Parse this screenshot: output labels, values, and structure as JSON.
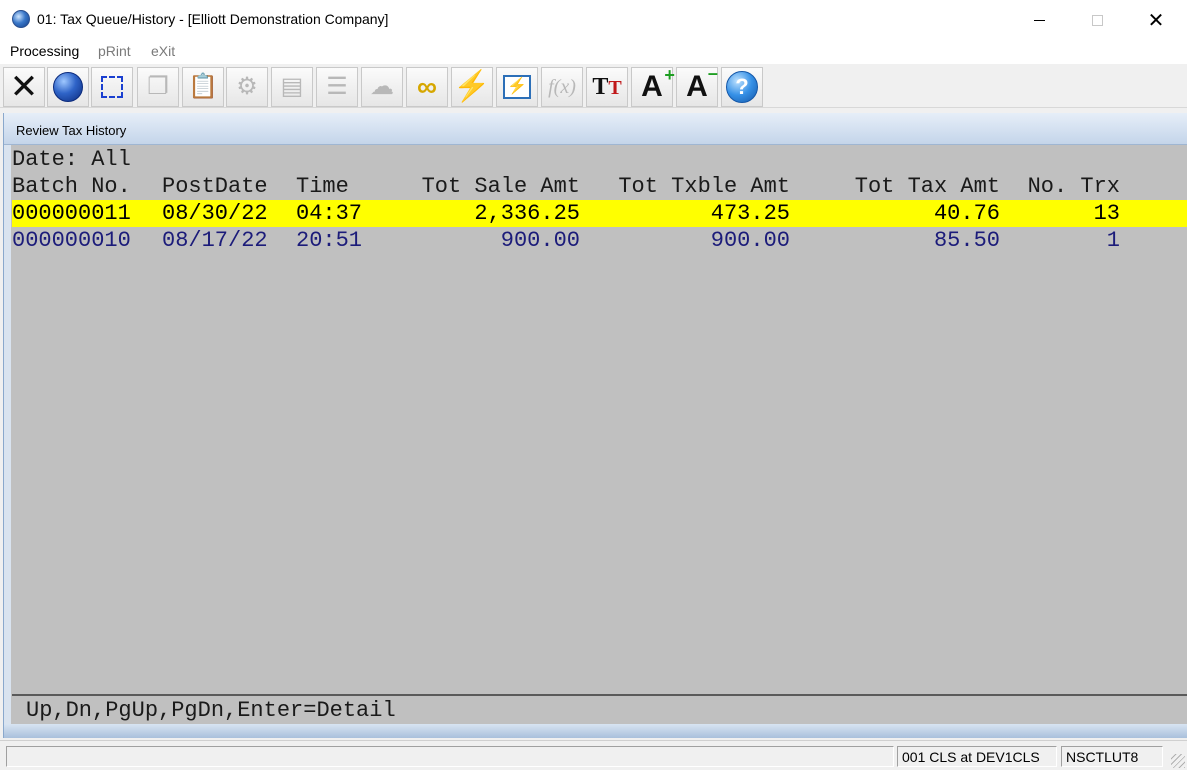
{
  "window": {
    "title": "01: Tax Queue/History - [Elliott Demonstration Company]"
  },
  "menu": {
    "processing": "Processing",
    "print": "pRint",
    "exit": "eXit"
  },
  "toolbar": {
    "items": [
      {
        "icon": "close-icon",
        "enabled": true
      },
      {
        "icon": "globe-icon",
        "enabled": true
      },
      {
        "icon": "select-box-icon",
        "enabled": true
      },
      {
        "icon": "copy-icon",
        "enabled": false
      },
      {
        "icon": "paste-icon",
        "enabled": false
      },
      {
        "icon": "gear-icon",
        "enabled": false
      },
      {
        "icon": "edit-form-icon",
        "enabled": false
      },
      {
        "icon": "table-icon",
        "enabled": false
      },
      {
        "icon": "users-icon",
        "enabled": false
      },
      {
        "icon": "link-icon",
        "enabled": true
      },
      {
        "icon": "lightning-icon",
        "enabled": true
      },
      {
        "icon": "presentation-icon",
        "enabled": true
      },
      {
        "icon": "function-icon",
        "enabled": false
      },
      {
        "icon": "font-style-icon",
        "enabled": true
      },
      {
        "icon": "font-increase-icon",
        "enabled": true
      },
      {
        "icon": "font-decrease-icon",
        "enabled": true
      },
      {
        "icon": "help-icon",
        "enabled": true
      }
    ]
  },
  "panel": {
    "title": "Review Tax History",
    "date_filter": "Date: All",
    "columns": {
      "batch": "Batch No.",
      "post_date": "PostDate",
      "time": "Time",
      "sale": "Tot Sale Amt",
      "taxable": "Tot Txble Amt",
      "tax": "Tot Tax Amt",
      "trx": "No. Trx"
    },
    "rows": [
      {
        "batch": "000000011",
        "post_date": "08/30/22",
        "time": "04:37",
        "sale": "2,336.25",
        "taxable": "473.25",
        "tax": "40.76",
        "trx": "13"
      },
      {
        "batch": "000000010",
        "post_date": "08/17/22",
        "time": "20:51",
        "sale": "900.00",
        "taxable": "900.00",
        "tax": "85.50",
        "trx": "1"
      }
    ],
    "hint": "Up,Dn,PgUp,PgDn,Enter=Detail"
  },
  "status": {
    "left": "",
    "session": "001 CLS at DEV1CLS",
    "machine": "NSCTLUT8"
  },
  "colors": {
    "selected_row_bg": "#ffff00",
    "row_text": "#1c1c7a",
    "panel_bg": "#c0c0c0"
  }
}
